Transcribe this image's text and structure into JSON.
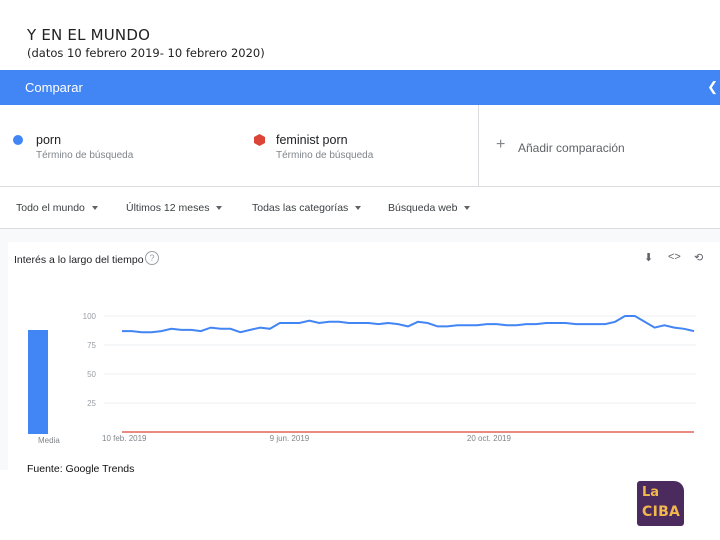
{
  "slide": {
    "title": "Y EN EL MUNDO",
    "subtitle": "(datos 10 febrero 2019- 10 febrero 2020)",
    "source": "Fuente: Google Trends"
  },
  "compare_bar": {
    "label": "Comparar",
    "share_icon": "share-arrow",
    "color": "#4285f4"
  },
  "terms": [
    {
      "name": "porn",
      "kind": "Término de búsqueda",
      "color": "#4285f4",
      "marker": "circle"
    },
    {
      "name": "feminist porn",
      "kind": "Término de búsqueda",
      "color": "#db4437",
      "marker": "hexagon"
    }
  ],
  "add_comparison": {
    "label": "Añadir comparación",
    "icon": "plus-icon"
  },
  "filters": [
    {
      "label": "Todo el mundo"
    },
    {
      "label": "Últimos 12 meses"
    },
    {
      "label": "Todas las categorías"
    },
    {
      "label": "Búsqueda web"
    }
  ],
  "interest_card": {
    "title": "Interés a lo largo del tiempo",
    "icons": [
      "help-icon",
      "download-icon",
      "embed-icon",
      "share-icon"
    ],
    "average_label": "Media"
  },
  "chart_data": {
    "type": "line",
    "x_tick_labels": [
      "10 feb. 2019",
      "9 jun. 2019",
      "20 oct. 2019"
    ],
    "y_tick_labels": [
      "100",
      "75",
      "50",
      "25"
    ],
    "ylim": [
      0,
      100
    ],
    "grid": true,
    "series": [
      {
        "name": "porn",
        "color": "#4285f4",
        "average": 87,
        "values": [
          87,
          87,
          86,
          86,
          87,
          89,
          88,
          88,
          87,
          90,
          89,
          89,
          86,
          88,
          90,
          89,
          94,
          94,
          94,
          96,
          94,
          95,
          95,
          94,
          94,
          94,
          93,
          94,
          93,
          91,
          95,
          94,
          91,
          91,
          92,
          92,
          92,
          93,
          93,
          92,
          92,
          93,
          93,
          94,
          94,
          94,
          93,
          93,
          93,
          93,
          95,
          100,
          100,
          95,
          90,
          92,
          90,
          89,
          87
        ]
      },
      {
        "name": "feminist porn",
        "color": "#db4437",
        "average": 0,
        "values": [
          0,
          0,
          0,
          0,
          0,
          0,
          0,
          0,
          0,
          0,
          0,
          0,
          0,
          0,
          0,
          0,
          0,
          0,
          0,
          0,
          0,
          0,
          0,
          0,
          0,
          0,
          0,
          0,
          0,
          0,
          0,
          0,
          0,
          0,
          0,
          0,
          0,
          0,
          0,
          0,
          0,
          0,
          0,
          0,
          0,
          0,
          0,
          0,
          0,
          0,
          0,
          0,
          0,
          0,
          0,
          0,
          0,
          0,
          0
        ]
      }
    ]
  },
  "logo": {
    "line1": "La",
    "line2": "CIBA",
    "bg": "#4b2a5e",
    "fg": "#f2b84b"
  }
}
